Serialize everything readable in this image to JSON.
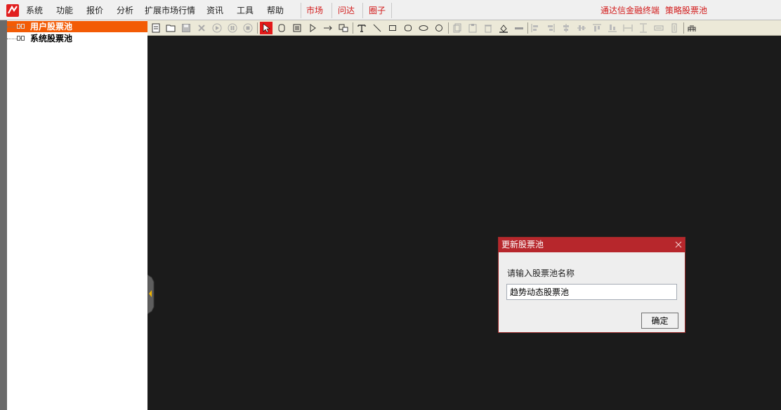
{
  "menu": {
    "items": [
      "系统",
      "功能",
      "报价",
      "分析",
      "扩展市场行情",
      "资讯",
      "工具",
      "帮助"
    ],
    "tabs": [
      "市场",
      "问达",
      "圈子"
    ],
    "right_links": [
      "通达信金融终端",
      "策略股票池"
    ]
  },
  "tree": {
    "items": [
      {
        "label": "用户股票池",
        "selected": true
      },
      {
        "label": "系统股票池",
        "selected": false
      }
    ]
  },
  "toolbar": {
    "icons": [
      "new-icon",
      "open-icon",
      "save-icon",
      "delete-icon",
      "play-icon",
      "pause-icon",
      "stop-icon",
      "pointer-icon",
      "select-icon",
      "note-icon",
      "triangle-icon",
      "arrow-icon",
      "group-icon",
      "text-icon",
      "line-icon",
      "rectangle-icon",
      "rounded-rect-icon",
      "ellipse-icon",
      "circle-icon",
      "copy-icon",
      "paste-icon",
      "trash-icon",
      "fill-icon",
      "line-width-icon",
      "align-left-icon",
      "align-right-icon",
      "align-center-icon",
      "align-middle-icon",
      "align-top-icon",
      "align-bottom-icon",
      "same-width-icon",
      "same-height-icon",
      "distribute-h-icon",
      "distribute-v-icon",
      "grid-icon"
    ],
    "active": "pointer-icon"
  },
  "dialog": {
    "title": "更新股票池",
    "prompt": "请输入股票池名称",
    "input_value": "趋势动态股票池",
    "ok_label": "确定"
  },
  "colors": {
    "menu_tab_red": "#d21a1a",
    "tree_selected": "#f35b05",
    "dialog_titlebar": "#b7272c",
    "canvas": "#1b1b1b",
    "toolbar": "#ece9d8"
  }
}
